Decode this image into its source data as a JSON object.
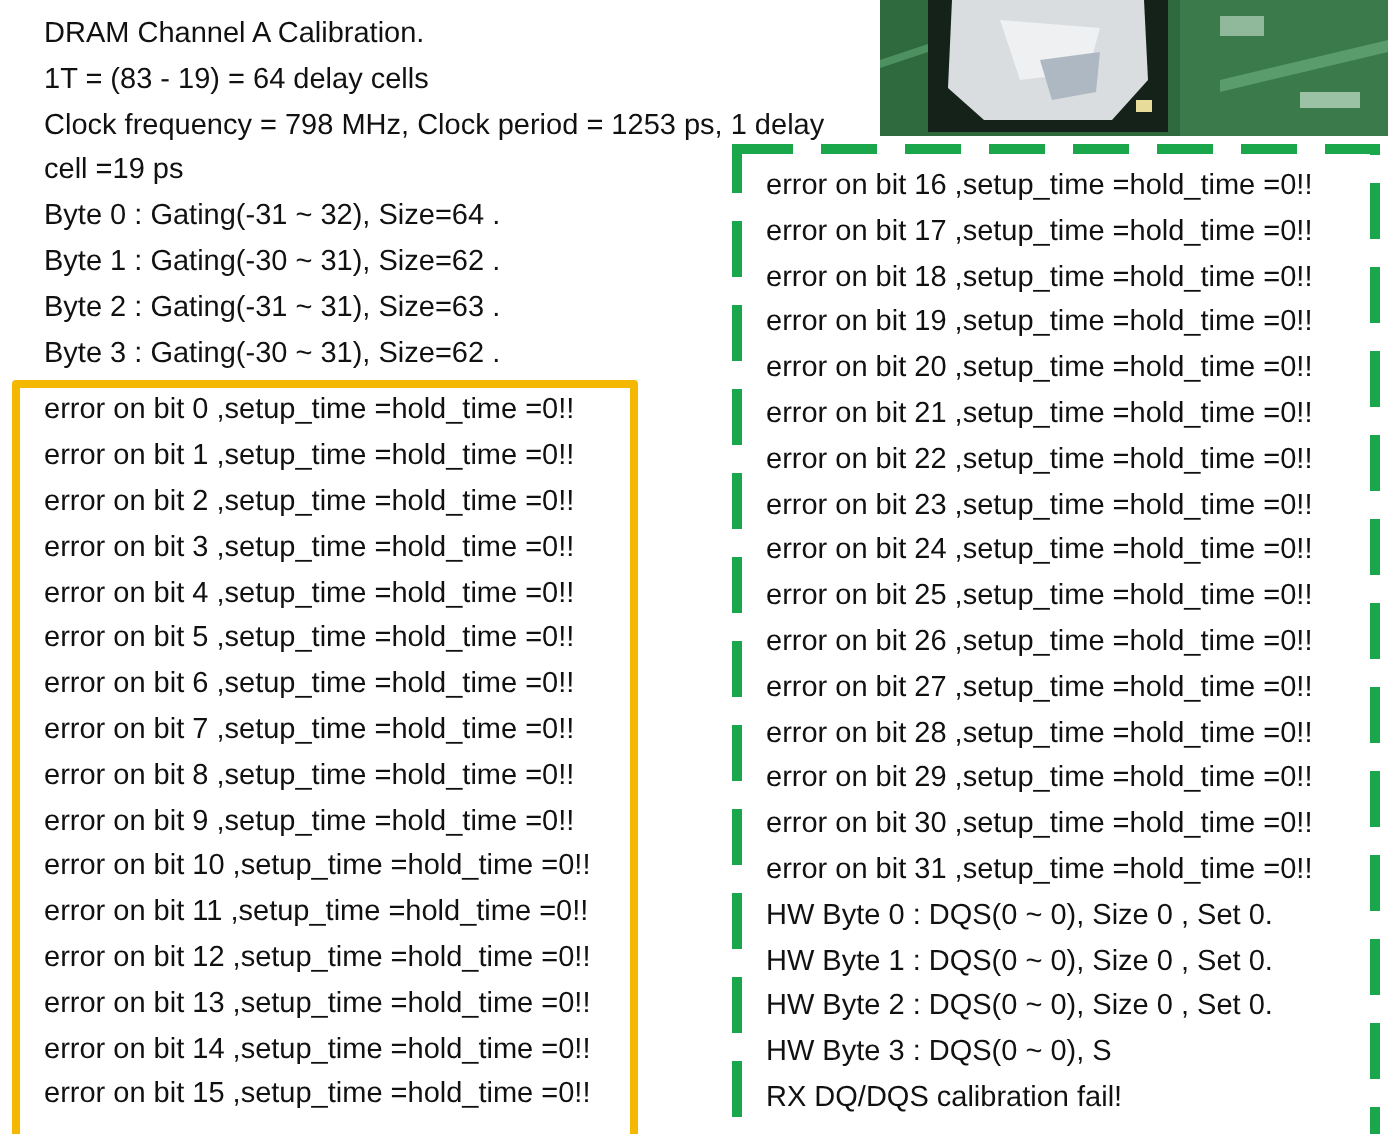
{
  "header_lines": [
    "DRAM Channel A Calibration.",
    "1T = (83 - 19) = 64 delay cells",
    "Clock frequency = 798 MHz, Clock period = 1253 ps, 1 delay",
    "cell =19 ps",
    "Byte 0 : Gating(-31 ~ 32), Size=64 .",
    "Byte 1 : Gating(-30 ~ 31), Size=62 .",
    "Byte 2 : Gating(-31 ~ 31), Size=63 .",
    "Byte 3 : Gating(-30 ~ 31), Size=62 ."
  ],
  "left_box": {
    "lines": [
      "error on bit 0 ,setup_time =hold_time =0!!",
      "error on bit 1 ,setup_time =hold_time =0!!",
      "error on bit 2 ,setup_time =hold_time =0!!",
      "error on bit 3 ,setup_time =hold_time =0!!",
      "error on bit 4 ,setup_time =hold_time =0!!",
      "error on bit 5 ,setup_time =hold_time =0!!",
      "error on bit 6 ,setup_time =hold_time =0!!",
      "error on bit 7 ,setup_time =hold_time =0!!",
      "error on bit 8 ,setup_time =hold_time =0!!",
      "error on bit 9 ,setup_time =hold_time =0!!",
      "error on bit 10 ,setup_time =hold_time =0!!",
      "error on bit 11 ,setup_time =hold_time =0!!",
      "error on bit 12 ,setup_time =hold_time =0!!",
      "error on bit 13 ,setup_time =hold_time =0!!",
      "error on bit 14 ,setup_time =hold_time =0!!",
      "error on bit 15 ,setup_time =hold_time =0!!"
    ]
  },
  "right_box": {
    "lines": [
      "error on bit 16 ,setup_time =hold_time =0!!",
      "error on bit 17 ,setup_time =hold_time =0!!",
      "error on bit 18 ,setup_time =hold_time =0!!",
      "error on bit 19 ,setup_time =hold_time =0!!",
      "error on bit 20 ,setup_time =hold_time =0!!",
      "error on bit 21 ,setup_time =hold_time =0!!",
      "error on bit 22 ,setup_time =hold_time =0!!",
      "error on bit 23 ,setup_time =hold_time =0!!",
      "error on bit 24 ,setup_time =hold_time =0!!",
      "error on bit 25 ,setup_time =hold_time =0!!",
      "error on bit 26 ,setup_time =hold_time =0!!",
      "error on bit 27 ,setup_time =hold_time =0!!",
      "error on bit 28 ,setup_time =hold_time =0!!",
      "error on bit 29 ,setup_time =hold_time =0!!",
      "error on bit 30 ,setup_time =hold_time =0!!",
      "error on bit 31 ,setup_time =hold_time =0!!",
      "HW Byte 0 : DQS(0 ~ 0), Size 0 , Set 0.",
      "HW Byte 1 : DQS(0 ~ 0), Size 0 , Set 0.",
      "HW Byte 2 : DQS(0 ~ 0), Size 0 , Set 0.",
      "HW Byte 3 : DQS(0 ~ 0), S",
      "RX DQ/DQS calibration fail!"
    ]
  }
}
